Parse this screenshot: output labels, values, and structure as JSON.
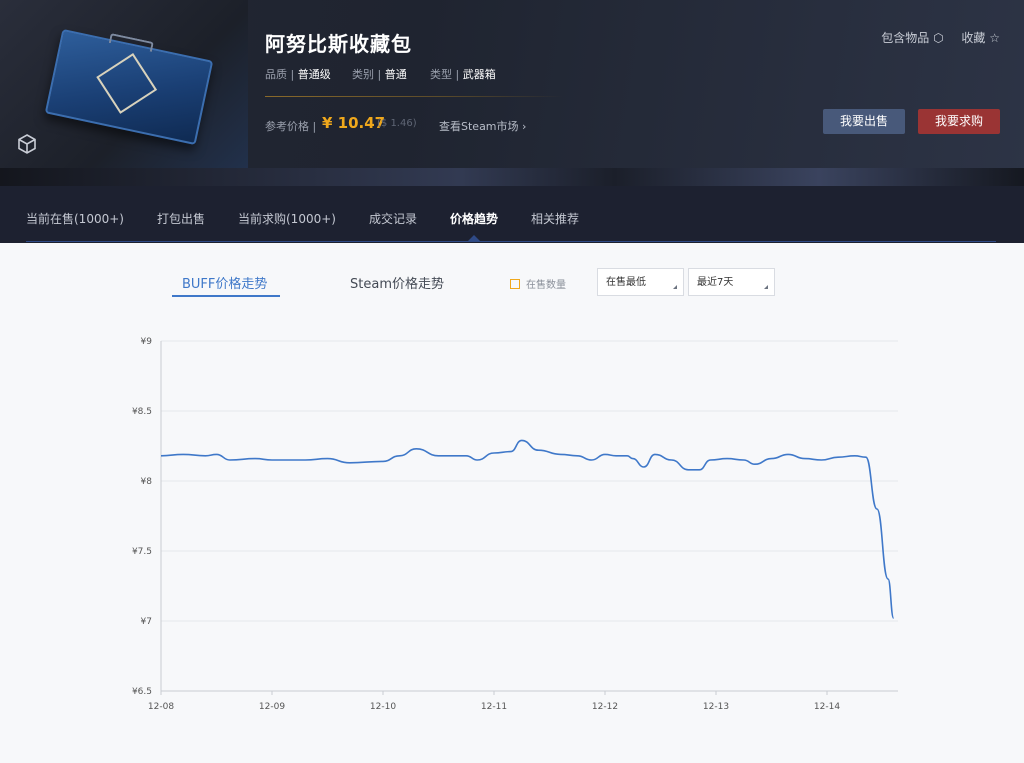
{
  "item": {
    "title": "阿努比斯收藏包",
    "quality_label": "品质 |",
    "quality_value": "普通级",
    "category_label": "类别 |",
    "category_value": "普通",
    "type_label": "类型 |",
    "type_value": "武器箱",
    "ref_label": "参考价格 |",
    "ref_price": "¥ 10.47",
    "ref_usd": "($ 1.46)",
    "steam_link": "查看Steam市场 ›"
  },
  "header_links": {
    "contents": "包含物品 ⬡",
    "favorite": "收藏 ☆"
  },
  "buttons": {
    "sell": "我要出售",
    "buy": "我要求购"
  },
  "tabs": [
    {
      "label": "当前在售(1000+)",
      "active": false
    },
    {
      "label": "打包出售",
      "active": false
    },
    {
      "label": "当前求购(1000+)",
      "active": false
    },
    {
      "label": "成交记录",
      "active": false
    },
    {
      "label": "价格趋势",
      "active": true
    },
    {
      "label": "相关推荐",
      "active": false
    }
  ],
  "chart_tabs": {
    "buff": "BUFF价格走势",
    "steam": "Steam价格走势"
  },
  "legend": {
    "label": "在售数量",
    "color": "#f0a81c"
  },
  "selects": {
    "metric": "在售最低",
    "range": "最近7天"
  },
  "colors": {
    "accent": "#3f78c9",
    "price": "#f0a81c",
    "sell": "#48597a",
    "buy": "#9a3434"
  },
  "chart_data": {
    "type": "line",
    "title": "",
    "xlabel": "",
    "ylabel": "",
    "ylim": [
      6.5,
      9
    ],
    "y_ticks": [
      "¥9",
      "¥8.5",
      "¥8",
      "¥7.5",
      "¥7",
      "¥6.5"
    ],
    "y_tick_values": [
      9,
      8.5,
      8,
      7.5,
      7,
      6.5
    ],
    "x_ticks": [
      "12-08",
      "12-09",
      "12-10",
      "12-11",
      "12-12",
      "12-13",
      "12-14"
    ],
    "x_range_days": [
      0,
      6.6
    ],
    "grid": true,
    "series": [
      {
        "color": "#3f78c9",
        "points": [
          [
            0,
            8.18
          ],
          [
            0.2,
            8.19
          ],
          [
            0.4,
            8.18
          ],
          [
            0.5,
            8.19
          ],
          [
            0.62,
            8.15
          ],
          [
            0.85,
            8.16
          ],
          [
            1.0,
            8.15
          ],
          [
            1.3,
            8.15
          ],
          [
            1.5,
            8.16
          ],
          [
            1.7,
            8.13
          ],
          [
            2.0,
            8.14
          ],
          [
            2.15,
            8.18
          ],
          [
            2.3,
            8.23
          ],
          [
            2.5,
            8.18
          ],
          [
            2.75,
            8.18
          ],
          [
            2.85,
            8.15
          ],
          [
            3.0,
            8.2
          ],
          [
            3.15,
            8.21
          ],
          [
            3.25,
            8.29
          ],
          [
            3.4,
            8.22
          ],
          [
            3.6,
            8.19
          ],
          [
            3.75,
            8.18
          ],
          [
            3.88,
            8.15
          ],
          [
            4.0,
            8.19
          ],
          [
            4.1,
            8.18
          ],
          [
            4.2,
            8.18
          ],
          [
            4.25,
            8.16
          ],
          [
            4.35,
            8.1
          ],
          [
            4.45,
            8.19
          ],
          [
            4.6,
            8.15
          ],
          [
            4.75,
            8.08
          ],
          [
            4.85,
            8.08
          ],
          [
            4.95,
            8.15
          ],
          [
            5.1,
            8.16
          ],
          [
            5.25,
            8.15
          ],
          [
            5.35,
            8.12
          ],
          [
            5.5,
            8.16
          ],
          [
            5.65,
            8.19
          ],
          [
            5.8,
            8.16
          ],
          [
            5.95,
            8.15
          ],
          [
            6.1,
            8.17
          ],
          [
            6.25,
            8.18
          ],
          [
            6.35,
            8.17
          ],
          [
            6.45,
            7.8
          ],
          [
            6.55,
            7.3
          ],
          [
            6.6,
            7.02
          ]
        ]
      }
    ]
  }
}
